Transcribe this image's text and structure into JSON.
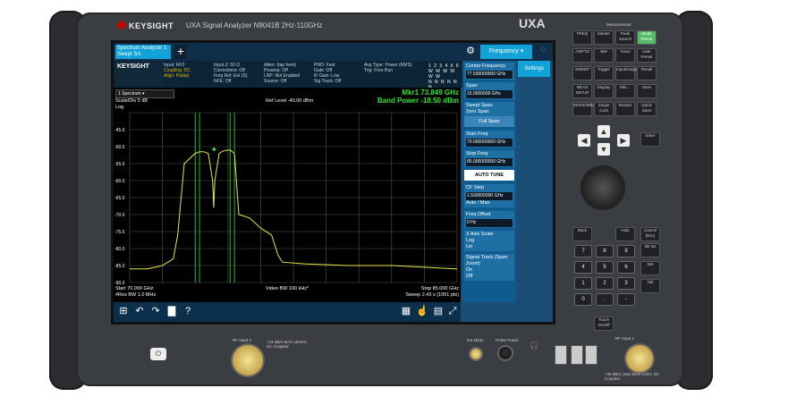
{
  "instrument": {
    "brand": "KEYSIGHT",
    "model": "UXA Signal Analyzer",
    "model_code": "N9041B",
    "range": "2Hz-110GHz",
    "badge": "UXA"
  },
  "screen": {
    "tab_label_1": "Spectrum Analyzer 1",
    "tab_label_2": "Swept SA",
    "add_tab": "+",
    "settings_icon": "gear-icon",
    "menu_title": "Frequency",
    "settings_tab": "Settings",
    "info_logo": "KEYSIGHT",
    "info": {
      "col1": [
        "Input: RF2",
        "Coupling: DC",
        "Align: Partial"
      ],
      "col2": [
        "Input Z: 50 Ω",
        "Corrections: Off",
        "Freq Ref: Ext (S)",
        "NFE: Off"
      ],
      "col3": [
        "Atten: (tap here)",
        "Preamp: Off",
        "LNP: Not Enabled",
        "Source: Off"
      ],
      "col4": [
        "PNO: Fast",
        "Gate: Off",
        "IF Gain: Low",
        "Sig Track: Off"
      ],
      "col5": [
        "Avg Type: Power (RMS)",
        "Trig: Free Run"
      ],
      "trace_row1": "1 2 3 4 5 6",
      "trace_row2": "W W W W W W",
      "trace_row3": "N N N N N N"
    },
    "view_select": "1 Spectrum",
    "scale": "Scale/Div 5 dB",
    "scale_type": "Log",
    "ref_level": "Ref Level -40.00 dBm",
    "marker": "Mkr1  73.849 GHz",
    "band_power": "Band Power  -18.50 dBm",
    "y_ticks": [
      "-45.0",
      "-50.0",
      "-55.0",
      "-60.0",
      "-65.0",
      "-70.0",
      "-75.0",
      "-80.0",
      "-85.0",
      "-90.0"
    ],
    "start_freq": "Start 70.000 GHz",
    "res_bw": "#Res BW 1.0 MHz",
    "video_bw": "Video BW 100 kHz*",
    "stop_freq": "Stop 85.000 GHz",
    "sweep": "Sweep 2.43 s (1001 pts)"
  },
  "softkeys": {
    "center_freq_label": "Center Frequency",
    "center_freq_value": "77.500000000 GHz",
    "span_label": "Span",
    "span_value": "15.0000000 GHz",
    "swept_span": "Swept Span",
    "zero_span": "Zero Span",
    "full_span": "Full Span",
    "start_freq_label": "Start Freq",
    "start_freq_value": "70.000000000 GHz",
    "stop_freq_label": "Stop Freq",
    "stop_freq_value": "85.000000000 GHz",
    "auto_tune": "AUTO TUNE",
    "cf_step_label": "CF Step",
    "cf_step_value": "1.500000000 GHz",
    "auto": "Auto",
    "man": "Man",
    "freq_offset_label": "Freq Offset",
    "freq_offset_value": "0 Hz",
    "xaxis_label": "X Axis Scale",
    "log": "Log",
    "lin": "Lin",
    "sig_track_label": "Signal Track (Span Zoom)",
    "on": "On",
    "off": "Off"
  },
  "hardkeys": {
    "section": "Measurement",
    "row1": [
      "FREQ",
      "Marker",
      "Peak Search",
      "Mode Preset"
    ],
    "row2": [
      "AMPTD",
      "BW",
      "Trace",
      "User Preset"
    ],
    "row3": [
      "SWEEP",
      "Trigger",
      "Input/Output",
      "Recall"
    ],
    "row4": [
      "MEAS SETUP",
      "Display",
      "Mkr→",
      "Save"
    ],
    "row5": [
      "MODE/MEAS",
      "Single Cont",
      "Restart",
      "Quick Save"
    ],
    "enter": "Enter",
    "back": "Back",
    "cancel": "Cancel (Esc)",
    "help": "Help",
    "nums": [
      "7",
      "8",
      "9",
      "4",
      "5",
      "6",
      "1",
      "2",
      "3",
      "0",
      ".",
      "-"
    ],
    "bksp": "Bk Sp",
    "del": "Del",
    "tab": "Tab",
    "touch": "Touch On/Off"
  },
  "front": {
    "rf_input_2": "RF Input 2",
    "rf_input_1": "RF Input 1",
    "ext_mixer": "Ext Mixer",
    "probe_power": "Probe Power",
    "input2_note": "+23 dBm MAX ±5VDC, DC Coupled",
    "input1_note": "+30 dBm (1W) MAX ±VDC DC Coupled"
  },
  "colors": {
    "trace": "#e8e64a",
    "marker": "#2ee82e",
    "accent": "#12a2d8"
  },
  "chart_data": {
    "type": "line",
    "x_range": [
      70.0,
      85.0
    ],
    "y_range": [
      -90,
      -40
    ],
    "x": [
      70.0,
      70.8,
      71.5,
      72.0,
      72.2,
      72.5,
      73.0,
      73.2,
      73.4,
      73.6,
      73.8,
      73.85,
      73.9,
      74.1,
      74.3,
      74.6,
      74.8,
      75.0,
      75.5,
      76.0,
      76.5,
      76.8,
      77.0,
      78.0,
      80.0,
      82.0,
      83.5,
      85.0
    ],
    "y": [
      -86,
      -86,
      -85,
      -83,
      -76,
      -55,
      -52,
      -51.5,
      -51.5,
      -52,
      -60,
      -68,
      -60,
      -52,
      -51.2,
      -51,
      -52,
      -70,
      -71,
      -74,
      -76,
      -82,
      -84,
      -84.5,
      -85,
      -85,
      -85.5,
      -86
    ],
    "lines": [
      73.0,
      73.2,
      74.6,
      74.8
    ]
  }
}
